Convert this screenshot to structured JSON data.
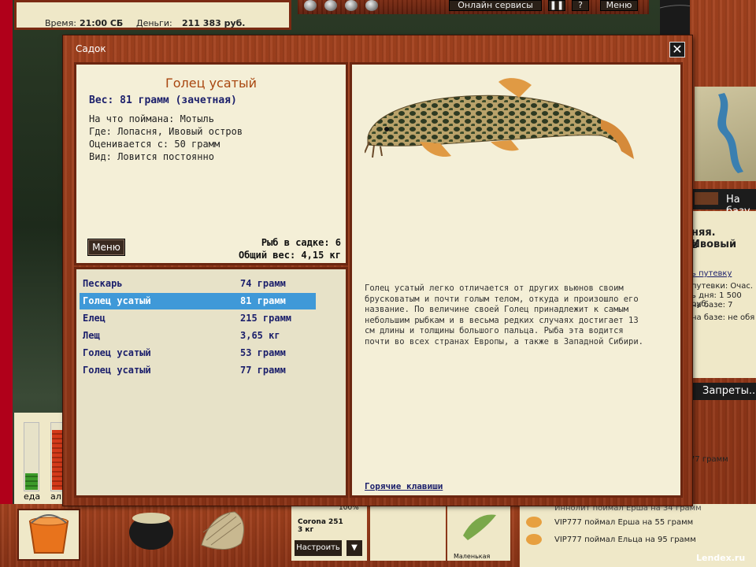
{
  "hud": {
    "time_label": "Время:",
    "time_value": "21:00 СБ",
    "money_label": "Деньги:",
    "money_value": "211 383 руб.",
    "online_services": "Онлайн сервисы",
    "pause_icon": "pause-icon",
    "help_label": "?",
    "menu_label": "Меню"
  },
  "right_panel": {
    "to_base": "На базу",
    "location": "няя. Ивовый",
    "location2": "в",
    "voucher_link": "ь путевку",
    "trip_line1": "путевки: Очас.",
    "trip_line2": "ь дня: 1 500 руб.",
    "trip_line3": "на базе: 7",
    "trip_line4": "на базе: не обя",
    "bans_button": "Запреты..."
  },
  "gauges": {
    "food_label": "еда",
    "alcohol_label": "ал",
    "food_level": 0.25,
    "alcohol_level": 0.9
  },
  "bottom": {
    "tackle_name": "Corona 251",
    "tackle_weight": "3 кг",
    "tackle_percent": "100%",
    "setup_button": "Настроить",
    "lure_name": "Маленькая",
    "chat": [
      "VIP777 поймал Ерша на 55 грамм",
      "VIP777 поймал Ельца на 95 грамм"
    ],
    "chat_partial_1": "Иннолит поймал Ерша на 34 грамм",
    "chat_partial_2": "77 грамм",
    "watermark": "Lendex.ru"
  },
  "dialog": {
    "title": "Садок",
    "close_icon": "close-icon",
    "fish_name": "Голец усатый",
    "fish_weight": "Вес: 81 грамм (зачетная)",
    "caught_with": "На что поймана: Мотыль",
    "location": "Где: Лопасня, Ивовый остров",
    "valued_from": "Оценивается с: 50 грамм",
    "kind": "Вид: Ловится постоянно",
    "menu_button": "Меню",
    "fish_count": "Рыб в садке: 6",
    "total_weight": "Общий вес: 4,15 кг",
    "fish_list": [
      {
        "name": "Пескарь",
        "weight": "74 грамм"
      },
      {
        "name": "Голец усатый",
        "weight": "81 грамм"
      },
      {
        "name": "Елец",
        "weight": "215 грамм"
      },
      {
        "name": "Лещ",
        "weight": "3,65 кг"
      },
      {
        "name": "Голец усатый",
        "weight": "53 грамм"
      },
      {
        "name": "Голец усатый",
        "weight": "77 грамм"
      }
    ],
    "selected_index": 1,
    "description": "Голец усатый легко отличается от других вьюнов своим брусковатым и почти голым телом, откуда и произошло его название. По величине своей Голец принадлежит к самым небольшим рыбкам и в весьма редких случаях достигает 13 см длины и толщины большого пальца. Рыба эта водится почти во всех странах Европы, а также в Западной Сибири.",
    "hotkeys": "Горячие клавиши"
  }
}
